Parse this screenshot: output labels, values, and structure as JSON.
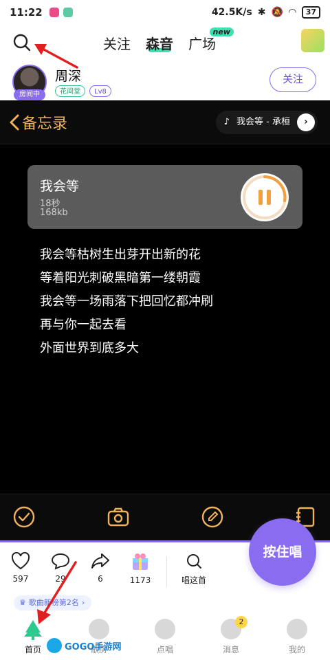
{
  "status_bar": {
    "time": "11:22",
    "network_speed": "42.5K/s",
    "battery": "37"
  },
  "top_nav": {
    "tabs": [
      "关注",
      "森音",
      "广场"
    ],
    "active_tab": "森音",
    "new_badge": "new"
  },
  "user": {
    "name": "周深",
    "room_tag": "房间中",
    "badge_hall": "花间堂",
    "badge_level": "Lv8",
    "follow_label": "关注"
  },
  "memo": {
    "back_label": "备忘录",
    "music_pill": "我会等 - 承桓",
    "audio": {
      "title": "我会等",
      "duration": "18秒",
      "size": "168kb"
    },
    "lyrics": [
      "我会等枯树生出芽开出新的花",
      "等着阳光刺破黑暗第一缕朝霞",
      "我会等一场雨落下把回忆都冲刷",
      "再与你一起去看",
      "外面世界到底多大"
    ]
  },
  "stats": {
    "likes": "597",
    "comments": "29",
    "shares": "6",
    "gifts": "1173",
    "sing_this_label": "唱这首"
  },
  "sing_button": "按住唱",
  "rank_chip": "歌曲新榜第2名",
  "bottom_nav": {
    "items": [
      "首页",
      "歌房",
      "点唱",
      "消息",
      "我的"
    ],
    "message_badge": "2"
  },
  "watermark": "GOGO手游网",
  "colors": {
    "accent_purple": "#8a6cf0",
    "accent_green": "#3ee0b0",
    "accent_orange": "#f0b35a",
    "annotation_red": "#e02020"
  }
}
